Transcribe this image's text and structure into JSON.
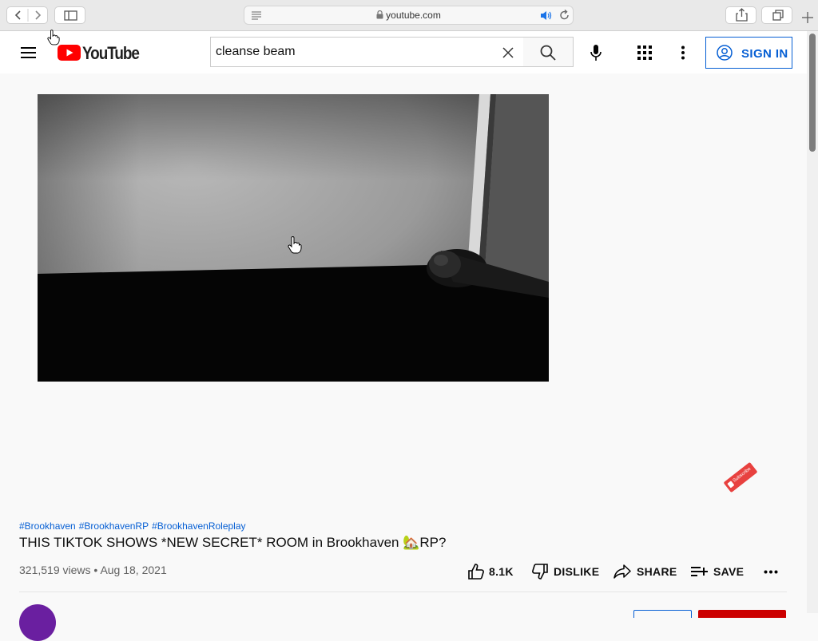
{
  "browser": {
    "url": "youtube.com"
  },
  "header": {
    "logo_text": "YouTube",
    "search_value": "cleanse beam",
    "search_placeholder": "Search",
    "signin_label": "SIGN IN"
  },
  "video": {
    "hashtags": [
      "#Brookhaven",
      "#BrookhavenRP",
      "#BrookhavenRoleplay"
    ],
    "title": "THIS TIKTOK SHOWS *NEW SECRET* ROOM in Brookhaven 🏡RP?",
    "views": "321,519 views",
    "date": "Aug 18, 2021",
    "likes": "8.1K",
    "dislike_label": "DISLIKE",
    "share_label": "SHARE",
    "save_label": "SAVE",
    "watermark": "Subscribe"
  },
  "colors": {
    "accent": "#065fd4",
    "youtube_red": "#ff0000"
  }
}
